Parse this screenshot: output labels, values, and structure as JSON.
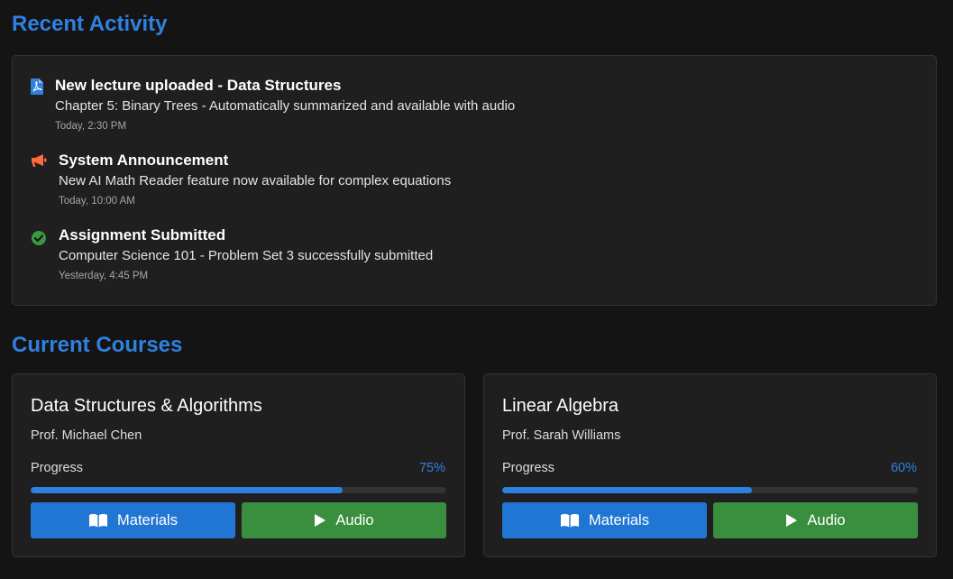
{
  "sections": {
    "activity_title": "Recent Activity",
    "courses_title": "Current Courses"
  },
  "activity": [
    {
      "icon": "pdf-file-icon",
      "icon_color": "#2f80e0",
      "title": "New lecture uploaded - Data Structures",
      "description": "Chapter 5: Binary Trees - Automatically summarized and available with audio",
      "time": "Today, 2:30 PM"
    },
    {
      "icon": "megaphone-icon",
      "icon_color": "#ff6b3d",
      "title": "System Announcement",
      "description": "New AI Math Reader feature now available for complex equations",
      "time": "Today, 10:00 AM"
    },
    {
      "icon": "check-circle-icon",
      "icon_color": "#3a9a40",
      "title": "Assignment Submitted",
      "description": "Computer Science 101 - Problem Set 3 successfully submitted",
      "time": "Yesterday, 4:45 PM"
    }
  ],
  "courses": [
    {
      "name": "Data Structures & Algorithms",
      "professor": "Prof. Michael Chen",
      "progress_label": "Progress",
      "progress_text": "75%",
      "progress": 0.75,
      "materials_label": "Materials",
      "audio_label": "Audio"
    },
    {
      "name": "Linear Algebra",
      "professor": "Prof. Sarah Williams",
      "progress_label": "Progress",
      "progress_text": "60%",
      "progress": 0.6,
      "materials_label": "Materials",
      "audio_label": "Audio"
    }
  ],
  "colors": {
    "accent": "#2f80e0",
    "materials_button": "#2176d4",
    "audio_button": "#3a8f3e",
    "background": "#141414",
    "card": "#1f1f1f"
  }
}
